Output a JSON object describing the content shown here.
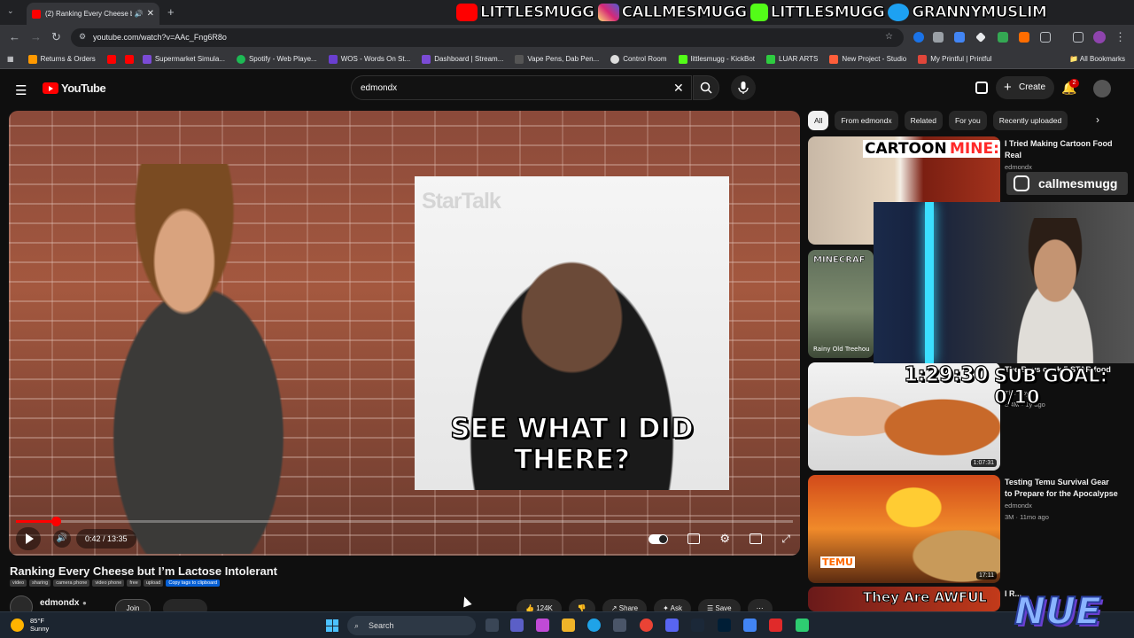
{
  "browser": {
    "tab_title": "(2) Ranking Every Cheese bu",
    "url": "youtube.com/watch?v=AAc_Fng6R8o",
    "bookmarks": [
      {
        "label": "Returns & Orders",
        "color": "#ff9900"
      },
      {
        "label": "",
        "color": "#ff0000"
      },
      {
        "label": "",
        "color": "#ff0000"
      },
      {
        "label": "Supermarket Simula...",
        "color": "#7b4bd6"
      },
      {
        "label": "Spotify - Web Playe...",
        "color": "#1db954"
      },
      {
        "label": "WOS - Words On St...",
        "color": "#6a3fd0"
      },
      {
        "label": "Dashboard | Stream...",
        "color": "#7b4bd6"
      },
      {
        "label": "Vape Pens, Dab Pen...",
        "color": "#333"
      },
      {
        "label": "Control Room",
        "color": "#444"
      },
      {
        "label": "littlesmugg - KickBot",
        "color": "#53fc18"
      },
      {
        "label": "LUAR ARTS",
        "color": "#2ecc40"
      },
      {
        "label": "New Project - Studio",
        "color": "#ff5e3a"
      },
      {
        "label": "My Printful | Printful",
        "color": "#e0463a"
      }
    ],
    "all_bookmarks": "All Bookmarks"
  },
  "overlay": {
    "socials": [
      {
        "handle": "LITTLESMUGG",
        "icon": "youtube-icon",
        "color": "#ff0000"
      },
      {
        "handle": "CALLMESMUGG",
        "icon": "instagram-icon",
        "color": "#d62976"
      },
      {
        "handle": "LITTLESMUGG",
        "icon": "kick-icon",
        "color": "#53fc18"
      },
      {
        "handle": "GRANNYMUSLIM",
        "icon": "twitter-icon",
        "color": "#1da1f2"
      }
    ],
    "ig_tag": "callmesmugg",
    "timer": "1:29:30",
    "goal": "SUB GOAL: 0/10",
    "logo_text": "NUE"
  },
  "youtube": {
    "logo": "YouTube",
    "search_query": "edmondx",
    "create_label": "Create",
    "notification_count": "2"
  },
  "player": {
    "gif_brand": "StarTalk",
    "gif_caption": "SEE WHAT I DID THERE?",
    "time": "0:42 / 13:35",
    "progress": 0.0515
  },
  "video": {
    "title": "Ranking Every Cheese but I’m Lactose Intolerant",
    "tags": [
      "video",
      "sharing",
      "camera phone",
      "video phone",
      "free",
      "upload"
    ],
    "copy_tags": "Copy tags to clipboard",
    "channel": "edmondx",
    "join_label": "Join",
    "actions": [
      {
        "label": "124K"
      },
      {
        "label": ""
      },
      {
        "label": "Share"
      },
      {
        "label": "Ask"
      },
      {
        "label": "Save"
      }
    ]
  },
  "chips": [
    "All",
    "From edmondx",
    "Related",
    "For you",
    "Recently uploaded"
  ],
  "recommendations": [
    {
      "title": "I Tried Making Cartoon Food Real",
      "channel": "edmondx",
      "meta": "",
      "duration": "",
      "thumb_text": "CARTOON:",
      "thumb_text2": "MINE:"
    },
    {
      "title": "",
      "channel": "",
      "meta": "",
      "duration": "",
      "thumb_text": "MINECRAF",
      "thumb_text2": "Rainy Old Treehou"
    },
    {
      "title": "The Boys cook 5 STAR food",
      "channel": "The Boys",
      "meta": "3.4M · 1y ago",
      "duration": "1:07:31",
      "thumb_text": "",
      "thumb_text2": ""
    },
    {
      "title": "Testing Temu Survival Gear to Prepare for the Apocalypse",
      "channel": "edmondx",
      "meta": "3M · 11mo ago",
      "duration": "17:11",
      "thumb_text": "",
      "thumb_text2": "TEMU"
    },
    {
      "title": "I R...",
      "channel": "",
      "meta": "",
      "duration": "",
      "thumb_text": "They Are AWFUL",
      "thumb_text2": ""
    }
  ],
  "taskbar": {
    "temp": "85°F",
    "condition": "Sunny",
    "search": "Search"
  }
}
